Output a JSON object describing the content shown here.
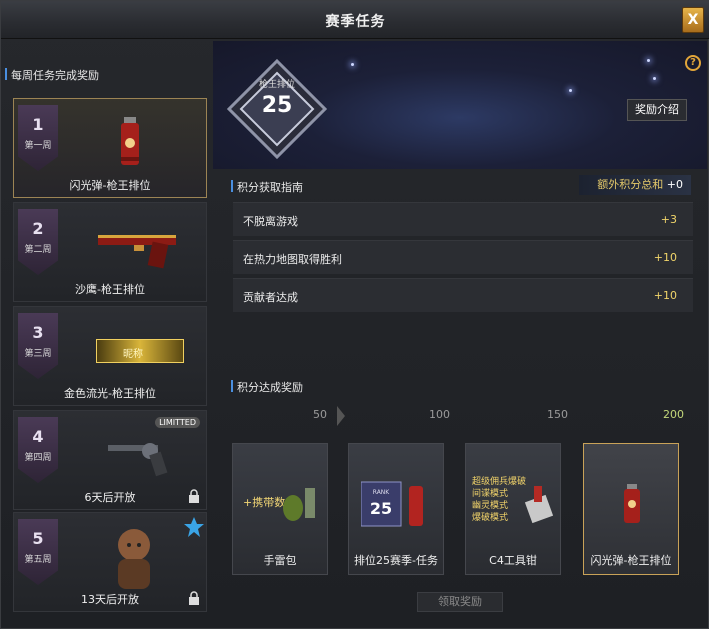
{
  "window": {
    "title": "赛季任务",
    "close_label": "X"
  },
  "left": {
    "header": "每周任务完成奖励",
    "weeks": [
      {
        "num": "1",
        "week": "第一周",
        "label": "闪光弹-枪王排位"
      },
      {
        "num": "2",
        "week": "第二周",
        "label": "沙鹰-枪王排位"
      },
      {
        "num": "3",
        "week": "第三周",
        "label": "金色流光-枪王排位",
        "item_text": "昵称"
      },
      {
        "num": "4",
        "week": "第四周",
        "label": "6天后开放",
        "badge": "LIMITTED"
      },
      {
        "num": "5",
        "week": "第五周",
        "label": "13天后开放"
      }
    ]
  },
  "hero": {
    "rank_title": "枪王排位",
    "rank_num": "25",
    "help": "?",
    "reward_intro": "奖励介绍"
  },
  "guide": {
    "title": "积分获取指南",
    "bonus_label": "额外积分总和",
    "bonus_value": "+0",
    "rows": [
      {
        "name": "不脱离游戏",
        "points": "+3"
      },
      {
        "name": "在热力地图取得胜利",
        "points": "+10"
      },
      {
        "name": "贡献者达成",
        "points": "+10"
      }
    ]
  },
  "rewards": {
    "title": "积分达成奖励",
    "milestones": [
      "50",
      "100",
      "150",
      "200"
    ],
    "cards": [
      {
        "label": "手雷包",
        "item_text": "+携带数"
      },
      {
        "label": "排位25赛季-任务",
        "item_text": "RANK 25"
      },
      {
        "label": "C4工具钳",
        "item_text": [
          "超级佣兵爆破",
          "间谍模式",
          "幽灵模式",
          "爆破模式"
        ]
      },
      {
        "label": "闪光弹-枪王排位"
      }
    ],
    "claim_label": "领取奖励"
  }
}
